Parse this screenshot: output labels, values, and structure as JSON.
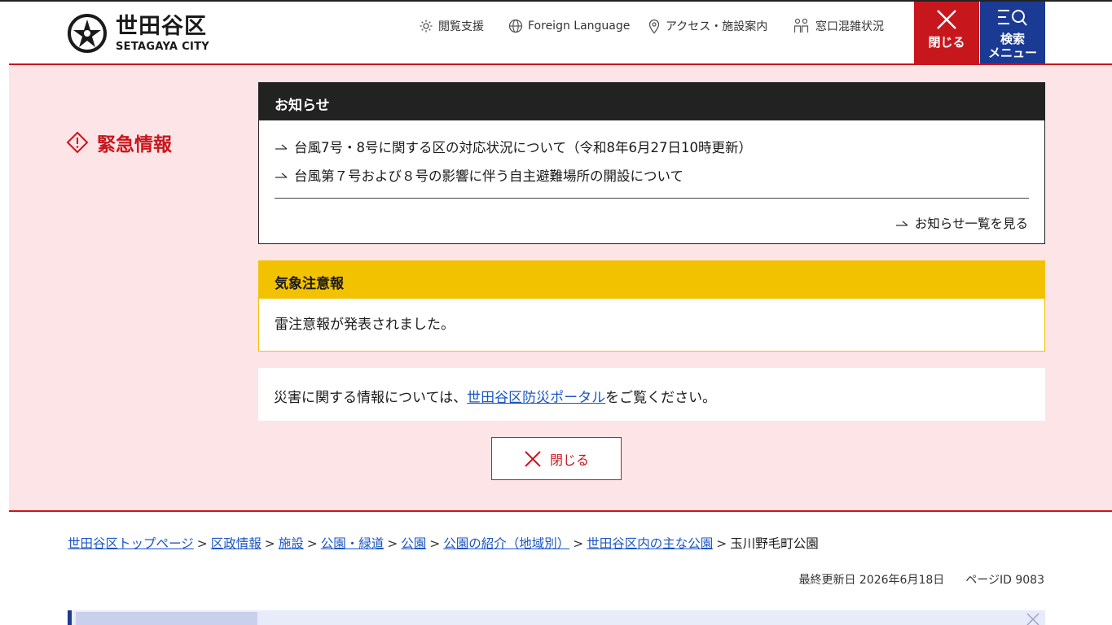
{
  "header": {
    "logo_jp": "世田谷区",
    "logo_en": "SETAGAYA CITY",
    "utility": [
      {
        "label": "閲覧支援",
        "icon": "gear-icon"
      },
      {
        "label": "Foreign Language",
        "icon": "globe-icon"
      },
      {
        "label": "アクセス・施設案内",
        "icon": "map-pin-icon"
      },
      {
        "label": "窓口混雑状況",
        "icon": "people-icon"
      }
    ],
    "close_label": "閉じる",
    "menu_label_1": "検索",
    "menu_label_2": "メニュー"
  },
  "emergency": {
    "title": "緊急情報",
    "notice": {
      "heading": "お知らせ",
      "items": [
        "台風7号・8号に関する区の対応状況について（令和8年6月27日10時更新）",
        "台風第７号および８号の影響に伴う自主避難場所の開設について"
      ],
      "more_label": "お知らせ一覧を見る"
    },
    "weather": {
      "heading": "気象注意報",
      "body": "雷注意報が発表されました。"
    },
    "info": {
      "before": "災害に関する情報については、",
      "link": "世田谷区防災ポータル",
      "after": "をご覧ください。"
    },
    "close_label": "閉じる"
  },
  "breadcrumb": {
    "links": [
      "世田谷区トップページ",
      "区政情報",
      "施設",
      "公園・緑道",
      "公園",
      "公園の紹介（地域別）",
      "世田谷区内の主な公園"
    ],
    "current": "玉川野毛町公園",
    "separator": ">"
  },
  "meta": {
    "updated": "最終更新日 2026年6月18日",
    "page_id": "ページID 9083"
  },
  "colors": {
    "accent_red": "#c8161d",
    "accent_navy": "#1b3a93",
    "warning_yellow": "#f2c200",
    "emergency_bg": "#fde4e6",
    "link_blue": "#1a55c4"
  }
}
